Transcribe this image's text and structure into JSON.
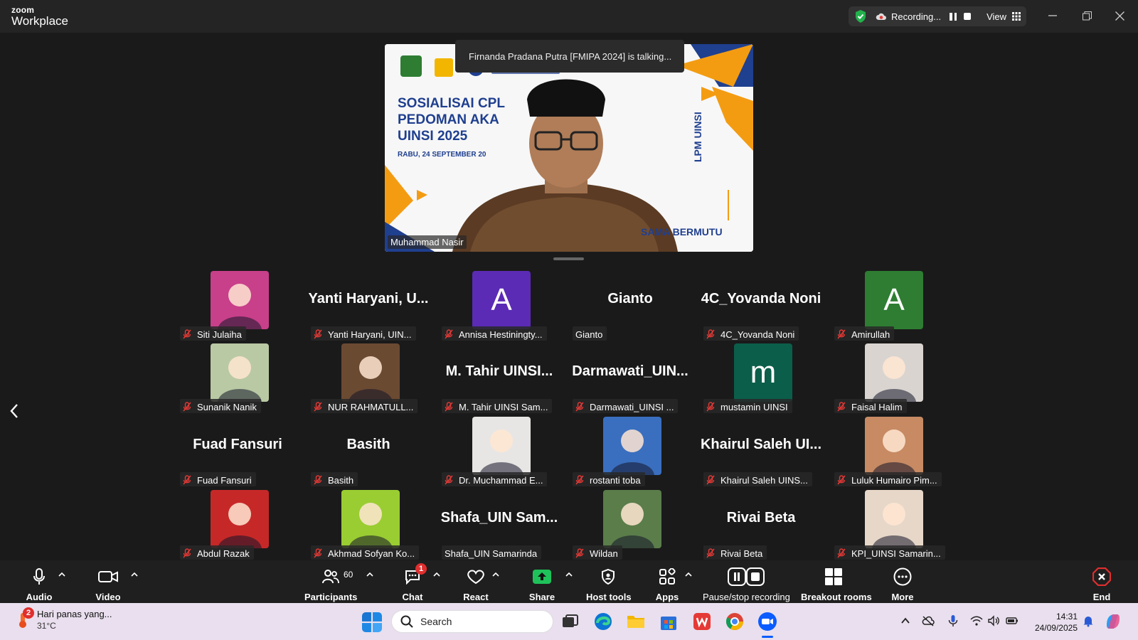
{
  "app": {
    "logo_top": "zoom",
    "logo_bottom": "Workplace"
  },
  "recording": {
    "label": "Recording...",
    "view_label": "View"
  },
  "speaker": {
    "talking_notice": "Firnanda Pradana Putra [FMIPA 2024] is talking...",
    "name": "Muhammad Nasir",
    "slide_title_1": "SOSIALISAI CPL",
    "slide_title_2": "PEDOMAN AKA",
    "slide_title_3": "UINSI 2025",
    "slide_date": "RABU, 24 SEPTEMBER 20",
    "slide_side": "LPM UINSI",
    "slide_footer": "SAMA BERMUTU"
  },
  "gallery": [
    {
      "label": "Siti Julaiha",
      "type": "photo",
      "bg": "#c83f8a"
    },
    {
      "label": "Yanti Haryani, UIN...",
      "type": "name",
      "display": "Yanti Haryani, U..."
    },
    {
      "label": "Annisa Hestiningty...",
      "type": "initial",
      "display": "A",
      "bg": "#5b2bb5"
    },
    {
      "label": "Gianto",
      "type": "name",
      "display": "Gianto",
      "muted": false
    },
    {
      "label": "4C_Yovanda Noni",
      "type": "name",
      "display": "4C_Yovanda Noni"
    },
    {
      "label": "Amirullah",
      "type": "initial",
      "display": "A",
      "bg": "#2e7d32"
    },
    {
      "label": "Sunanik Nanik",
      "type": "photo",
      "bg": "#b9c9a4"
    },
    {
      "label": "NUR RAHMATULL...",
      "type": "photo",
      "bg": "#6b4a32"
    },
    {
      "label": "M. Tahir UINSI Sam...",
      "type": "name",
      "display": "M. Tahir UINSI..."
    },
    {
      "label": "Darmawati_UINSI ...",
      "type": "name",
      "display": "Darmawati_UIN..."
    },
    {
      "label": "mustamin UINSI",
      "type": "initial",
      "display": "m",
      "bg": "#0b5e4a"
    },
    {
      "label": "Faisal Halim",
      "type": "photo",
      "bg": "#d9d4d0"
    },
    {
      "label": "Fuad Fansuri",
      "type": "name",
      "display": "Fuad Fansuri"
    },
    {
      "label": "Basith",
      "type": "name",
      "display": "Basith"
    },
    {
      "label": "Dr. Muchammad E...",
      "type": "photo",
      "bg": "#e8e6e4"
    },
    {
      "label": "rostanti toba",
      "type": "photo",
      "bg": "#3a6fbf"
    },
    {
      "label": "Khairul Saleh UINS...",
      "type": "name",
      "display": "Khairul Saleh UI..."
    },
    {
      "label": "Luluk Humairo Pim...",
      "type": "photo",
      "bg": "#c78a63"
    },
    {
      "label": "Abdul Razak",
      "type": "photo",
      "bg": "#c62828"
    },
    {
      "label": "Akhmad Sofyan Ko...",
      "type": "photo",
      "bg": "#9acd32"
    },
    {
      "label": "Shafa_UIN Samarinda",
      "type": "name",
      "display": "Shafa_UIN  Sam...",
      "muted": false
    },
    {
      "label": "Wildan",
      "type": "photo",
      "bg": "#5a7d4a"
    },
    {
      "label": "Rivai Beta",
      "type": "name",
      "display": "Rivai Beta"
    },
    {
      "label": "KPI_UINSI Samarin...",
      "type": "photo",
      "bg": "#e6d7c8"
    }
  ],
  "toolbar": {
    "audio": "Audio",
    "video": "Video",
    "participants": "Participants",
    "participants_count": "60",
    "chat": "Chat",
    "chat_badge": "1",
    "react": "React",
    "share": "Share",
    "host_tools": "Host tools",
    "apps": "Apps",
    "pause_recording": "Pause/stop recording",
    "breakout": "Breakout rooms",
    "more": "More",
    "end": "End"
  },
  "taskbar": {
    "weather_badge": "2",
    "weather_text": "Hari panas yang...",
    "weather_temp": "31°C",
    "search_placeholder": "Search",
    "time": "14:31",
    "date": "24/09/2025"
  },
  "colors": {
    "share_green": "#1fc25a",
    "end_red": "#e02e2e",
    "zoom_blue": "#0b5cff"
  }
}
